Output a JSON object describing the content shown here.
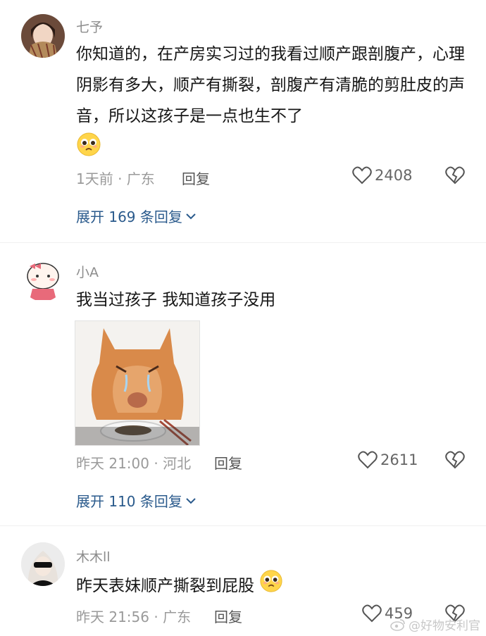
{
  "comments": [
    {
      "username": "七予",
      "text": "你知道的，在产房实习过的我看过顺产跟剖腹产，心理阴影有多大，顺产有撕裂，剖腹产有清脆的剪肚皮的声音，所以这孩子是一点也生不了",
      "time_location": "1天前 · 广东",
      "reply_label": "回复",
      "likes": "2408",
      "expand_label": "展开 169 条回复"
    },
    {
      "username": "小A",
      "text": "我当过孩子 我知道孩子没用",
      "time_location": "昨天 21:00 · 河北",
      "reply_label": "回复",
      "likes": "2611",
      "expand_label": "展开 110 条回复"
    },
    {
      "username": "木木ll",
      "text": "昨天表妹顺产撕裂到屁股",
      "time_location": "昨天 21:56 · 广东",
      "reply_label": "回复",
      "likes": "459"
    }
  ],
  "watermark": "@好物安利官",
  "icons": {
    "like": "heart-outline-icon",
    "dislike": "broken-heart-icon",
    "expand": "chevron-down-icon",
    "emoji": "pleading-face-emoji"
  },
  "colors": {
    "link": "#2a5a8c",
    "meta": "#9a9a9a"
  }
}
